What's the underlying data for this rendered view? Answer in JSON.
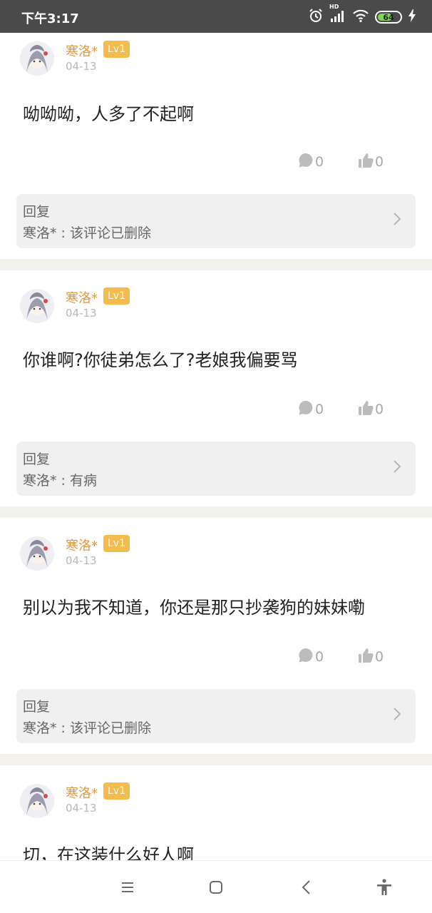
{
  "status_bar": {
    "time": "下午3:17",
    "battery": "64",
    "hd_label": "HD"
  },
  "comments": [
    {
      "user": "寒洛*",
      "level": "Lv1",
      "date": "04-13",
      "text": "呦呦呦，人多了不起啊",
      "comment_count": "0",
      "like_count": "0",
      "reply_label": "回复",
      "reply_text": "寒洛* : 该评论已删除"
    },
    {
      "user": "寒洛*",
      "level": "Lv1",
      "date": "04-13",
      "text": "你谁啊?你徒弟怎么了?老娘我偏要骂",
      "comment_count": "0",
      "like_count": "0",
      "reply_label": "回复",
      "reply_text": "寒洛* : 有病"
    },
    {
      "user": "寒洛*",
      "level": "Lv1",
      "date": "04-13",
      "text": "别以为我不知道，你还是那只抄袭狗的妹妹嘞",
      "comment_count": "0",
      "like_count": "0",
      "reply_label": "回复",
      "reply_text": "寒洛* : 该评论已删除"
    },
    {
      "user": "寒洛*",
      "level": "Lv1",
      "date": "04-13",
      "text": "切，在这装什么好人啊"
    }
  ],
  "icons": {
    "alarm": "alarm-icon",
    "signal": "signal-icon",
    "wifi": "wifi-icon",
    "charging": "charging-icon",
    "comment": "comment-bubble-icon",
    "like": "thumbs-up-icon",
    "reply_arrow": "chevron-right-icon",
    "menu": "menu-icon",
    "home": "home-icon",
    "back": "back-icon",
    "accessibility": "accessibility-icon"
  },
  "colors": {
    "username": "#e2973f",
    "level_badge": "#f5bb4c",
    "status_bar": "#4a4a4a",
    "separator": "#f2f1ec"
  }
}
